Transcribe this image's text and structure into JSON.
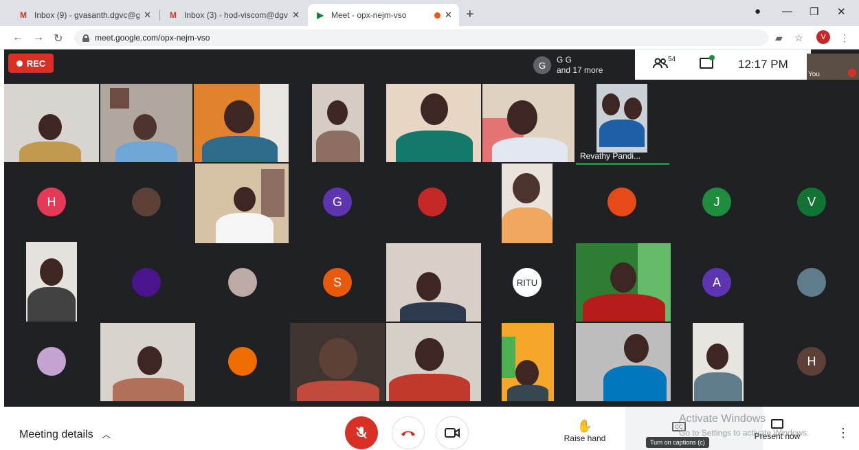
{
  "browser": {
    "tabs": [
      {
        "title": "Inbox (9) - gvasanth.dgvc@gma",
        "favicon": "gmail-icon",
        "active": false
      },
      {
        "title": "Inbox (3) - hod-viscom@dgvaish",
        "favicon": "gmail-icon",
        "active": false
      },
      {
        "title": "Meet - opx-nejm-vso",
        "favicon": "meet-icon",
        "active": true
      }
    ],
    "url": "meet.google.com/opx-nejm-vso",
    "profile_initial": "V"
  },
  "meet": {
    "rec_label": "REC",
    "presenter_initial": "G",
    "presenter_name": "G G",
    "presenter_more": "and 17 more",
    "participant_count": "54",
    "time": "12:17 PM",
    "self_label": "You",
    "tiles": {
      "revathy": "Revathy Pandi...",
      "avatars": {
        "h1": "H",
        "g": "G",
        "j": "J",
        "v": "V",
        "s": "S",
        "ritu": "RITU",
        "a": "A",
        "h2": "H"
      }
    },
    "colors": {
      "rec": "#d93025",
      "avatar_h1": "#e53958",
      "avatar_g": "#5e35b1",
      "avatar_j": "#1e8e3e",
      "avatar_v": "#137333",
      "avatar_s": "#e8590c",
      "avatar_ritu": "#ffffff",
      "avatar_a": "#5e35b1",
      "avatar_h2": "#5d4037"
    }
  },
  "bottom": {
    "meeting_details": "Meeting details",
    "raise_hand": "Raise hand",
    "captions_tooltip": "Turn on captions (c)",
    "activate_title": "Activate Windows",
    "activate_sub": "Go to Settings to activate Windows.",
    "present_now": "Present now"
  }
}
